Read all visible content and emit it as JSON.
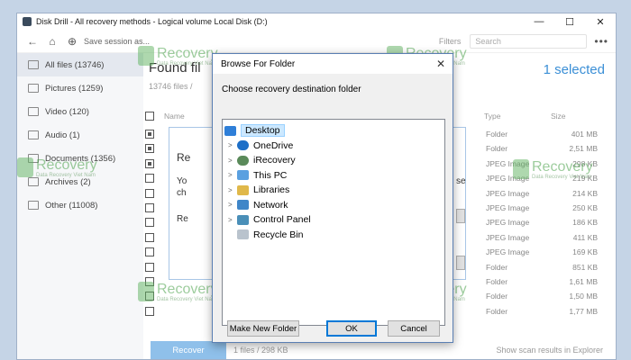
{
  "window": {
    "title": "Disk Drill - All recovery methods - Logical volume Local Disk (D:)"
  },
  "toolbar": {
    "save_session": "Save session as...",
    "filters": "Filters",
    "search_placeholder": "Search"
  },
  "sidebar": {
    "items": [
      {
        "label": "All files (13746)",
        "icon": "files-icon"
      },
      {
        "label": "Pictures (1259)",
        "icon": "pictures-icon"
      },
      {
        "label": "Video (120)",
        "icon": "video-icon"
      },
      {
        "label": "Audio (1)",
        "icon": "audio-icon"
      },
      {
        "label": "Documents (1356)",
        "icon": "documents-icon"
      },
      {
        "label": "Archives (2)",
        "icon": "archives-icon"
      },
      {
        "label": "Other (11008)",
        "icon": "other-icon"
      }
    ]
  },
  "main": {
    "title": "Found fil",
    "subtitle": "13746 files /",
    "selected": "1 selected",
    "columns": {
      "name": "Name",
      "type": "Type",
      "size": "Size"
    },
    "rows": [
      {
        "type": "Folder",
        "size": "401 MB",
        "checked": true
      },
      {
        "type": "Folder",
        "size": "2,51 MB",
        "checked": true
      },
      {
        "type": "JPEG Image",
        "size": "298 KB",
        "checked": true
      },
      {
        "type": "JPEG Image",
        "size": "219 KB",
        "checked": false
      },
      {
        "type": "JPEG Image",
        "size": "214 KB",
        "checked": false
      },
      {
        "type": "JPEG Image",
        "size": "250 KB",
        "checked": false
      },
      {
        "type": "JPEG Image",
        "size": "186 KB",
        "checked": false
      },
      {
        "type": "JPEG Image",
        "size": "411 KB",
        "checked": false
      },
      {
        "type": "JPEG Image",
        "size": "169 KB",
        "checked": false
      },
      {
        "type": "Folder",
        "size": "851 KB",
        "checked": false
      },
      {
        "type": "Folder",
        "size": "1,61 MB",
        "checked": false
      },
      {
        "type": "Folder",
        "size": "1,50 MB",
        "checked": false
      },
      {
        "type": "Folder",
        "size": "1,77 MB",
        "checked": false
      }
    ],
    "recover_button": "Recover",
    "status_files": "1 files / 298 KB",
    "show_results": "Show scan results in Explorer"
  },
  "background_dialog": {
    "title_fragment": "Re",
    "line1": "Yo",
    "line1_tail": "se",
    "line2": "ch",
    "line3": "Re"
  },
  "watermark": {
    "name": "Recovery",
    "subtitle": "Data Recovery Viet Nam"
  },
  "dialog": {
    "title": "Browse For Folder",
    "description": "Choose recovery destination folder",
    "tree": [
      {
        "label": "Desktop",
        "icon": "desktop-icon",
        "chevron": "",
        "selected": true
      },
      {
        "label": "OneDrive",
        "icon": "onedrive-icon",
        "chevron": ">",
        "selected": false
      },
      {
        "label": "iRecovery",
        "icon": "user-icon",
        "chevron": ">",
        "selected": false
      },
      {
        "label": "This PC",
        "icon": "this-pc-icon",
        "chevron": ">",
        "selected": false
      },
      {
        "label": "Libraries",
        "icon": "libraries-icon",
        "chevron": ">",
        "selected": false
      },
      {
        "label": "Network",
        "icon": "network-icon",
        "chevron": ">",
        "selected": false
      },
      {
        "label": "Control Panel",
        "icon": "control-panel-icon",
        "chevron": ">",
        "selected": false
      },
      {
        "label": "Recycle Bin",
        "icon": "recycle-bin-icon",
        "chevron": "",
        "selected": false
      }
    ],
    "make_new_folder": "Make New Folder",
    "ok": "OK",
    "cancel": "Cancel"
  }
}
